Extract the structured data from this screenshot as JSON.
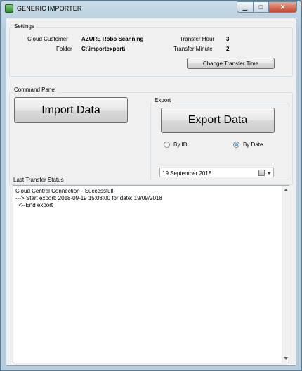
{
  "window": {
    "title": "GENERIC IMPORTER",
    "min_glyph": "▁",
    "max_glyph": "□",
    "close_glyph": "✕"
  },
  "settings": {
    "group_title": "Settings",
    "cloud_customer_label": "Cloud Customer",
    "cloud_customer_value": "AZURE Robo Scanning",
    "folder_label": "Folder",
    "folder_value": "C:\\importexport\\",
    "transfer_hour_label": "Transfer Hour",
    "transfer_hour_value": "3",
    "transfer_minute_label": "Transfer Minute",
    "transfer_minute_value": "2",
    "change_time_button": "Change Transfer Time"
  },
  "command_panel": {
    "group_title": "Command Panel",
    "import_button": "Import Data"
  },
  "export": {
    "group_title": "Export",
    "export_button": "Export Data",
    "by_id_label": "By ID",
    "by_date_label": "By Date",
    "selected": "By Date",
    "date_value": "19 September 2018"
  },
  "status": {
    "label": "Last Transfer Status",
    "lines": [
      "Cloud Central Connection - Successfull",
      "---> Start export: 2018-09-19 15:03:00 for date: 19/09/2018",
      "  <--End export"
    ]
  }
}
